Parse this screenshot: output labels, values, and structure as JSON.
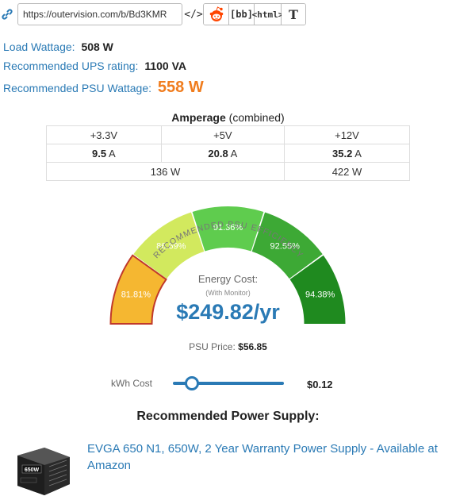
{
  "share": {
    "url": "https://outervision.com/b/Bd3KMR",
    "code_label": "</>",
    "bb_label": "[bb]",
    "html_label": "<html>",
    "text_label": "T"
  },
  "stats": {
    "load_label": "Load Wattage:",
    "load_value": "508 W",
    "ups_label": "Recommended UPS rating:",
    "ups_value": "1100 VA",
    "psu_label": "Recommended PSU Wattage:",
    "psu_value": "558 W"
  },
  "amperage": {
    "title": "Amperage",
    "title_suffix": "(combined)",
    "rails": [
      "+3.3V",
      "+5V",
      "+12V"
    ],
    "amps": [
      "9.5",
      "20.8",
      "35.2"
    ],
    "unit": "A",
    "combined_low": "136 W",
    "combined_high": "422 W"
  },
  "gauge": {
    "title": "RECOMMENDED PSU EFFICIENCY",
    "segments": [
      {
        "label": "81.81%",
        "color": "#f5b731",
        "selected": true
      },
      {
        "label": "86.69%",
        "color": "#d2e95e"
      },
      {
        "label": "91.36%",
        "color": "#5fcc4e"
      },
      {
        "label": "92.55%",
        "color": "#3da935"
      },
      {
        "label": "94.38%",
        "color": "#1f8a1f"
      }
    ],
    "selected_border": "#c0392b"
  },
  "energy": {
    "label": "Energy Cost:",
    "sub": "(With Monitor)",
    "value": "$249.82/yr"
  },
  "price": {
    "label": "PSU Price:",
    "value": "$56.85"
  },
  "kwh": {
    "label": "kWh Cost",
    "value": "$0.12",
    "slider_fraction": 0.17
  },
  "recommendation": {
    "title": "Recommended Power Supply:",
    "product_link": "EVGA 650 N1, 650W, 2 Year Warranty Power Supply - Available at Amazon",
    "product_badge": "650W"
  },
  "colors": {
    "link": "#2a7ab5",
    "accent": "#f07c1d"
  }
}
